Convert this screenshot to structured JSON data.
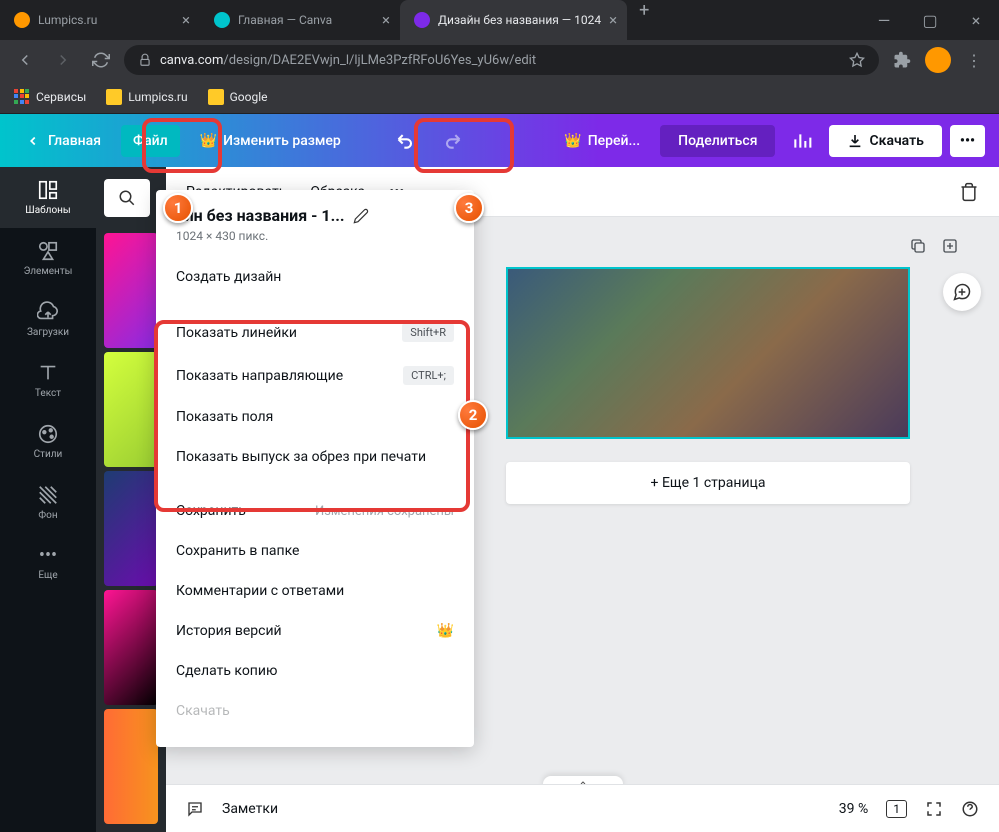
{
  "browser": {
    "tabs": [
      {
        "title": "Lumpics.ru",
        "icon_color": "#ff9800"
      },
      {
        "title": "Главная — Canva",
        "icon_color": "#00c4cc"
      },
      {
        "title": "Дизайн без названия — 1024",
        "icon_color": "#7d2ae8"
      }
    ],
    "url_domain": "canva.com",
    "url_path": "/design/DAE2EVwjn_l/ljLMe3PzfRFoU6Yes_yU6w/edit",
    "bookmarks": [
      {
        "label": "Сервисы"
      },
      {
        "label": "Lumpics.ru"
      },
      {
        "label": "Google"
      }
    ]
  },
  "toolbar": {
    "home": "Главная",
    "file": "Файл",
    "resize": "Изменить размер",
    "upgrade": "Перей...",
    "share": "Поделиться",
    "download": "Скачать"
  },
  "sidepanel": {
    "templates": "Шаблоны",
    "elements": "Элементы",
    "uploads": "Загрузки",
    "text": "Текст",
    "styles": "Стили",
    "background": "Фон",
    "more": "Еще"
  },
  "dropdown": {
    "title": "айн без названия - 1...",
    "subtitle": "1024 × 430 пикс.",
    "create": "Создать дизайн",
    "rulers": "Показать линейки",
    "rulers_shortcut": "Shift+R",
    "guides": "Показать направляющие",
    "guides_shortcut": "CTRL+;",
    "margins": "Показать поля",
    "bleed": "Показать выпуск за обрез при печати",
    "save": "Сохранить",
    "saved_status": "Изменения сохранены",
    "save_folder": "Сохранить в папке",
    "comments": "Комментарии с ответами",
    "history": "История версий",
    "copy": "Сделать копию",
    "download_item": "Скачать"
  },
  "context_bar": {
    "edit": "Редактировать",
    "crop": "Обрезка"
  },
  "canvas": {
    "add_page": "+ Еще 1 страница"
  },
  "footer": {
    "notes": "Заметки",
    "zoom": "39 %",
    "pages": "1"
  },
  "badges": {
    "b1": "1",
    "b2": "2",
    "b3": "3"
  }
}
